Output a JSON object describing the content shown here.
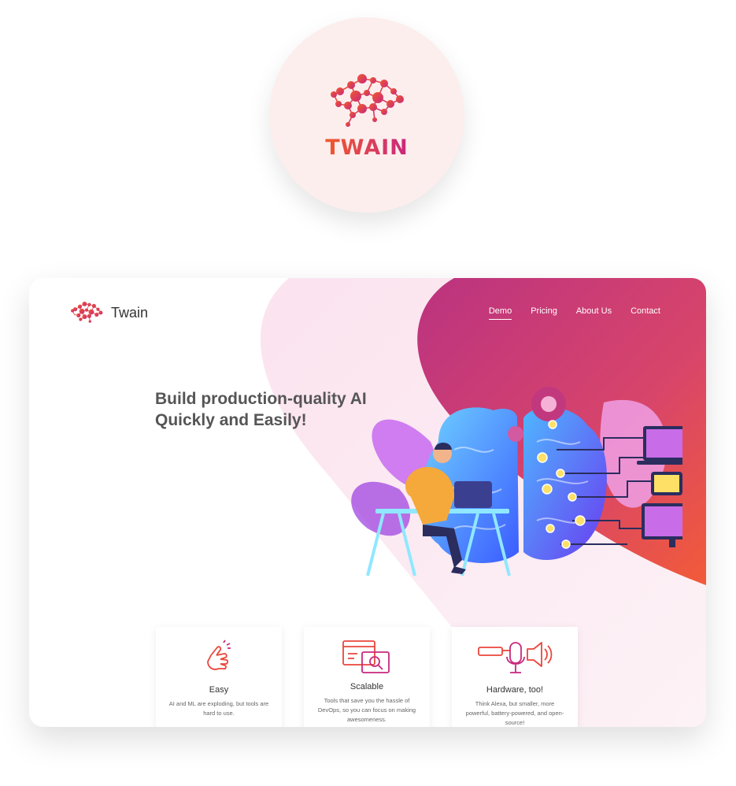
{
  "logo": {
    "wordmark": "TWAIN"
  },
  "site": {
    "brand": "Twain",
    "nav": [
      {
        "label": "Demo",
        "active": true
      },
      {
        "label": "Pricing",
        "active": false
      },
      {
        "label": "About Us",
        "active": false
      },
      {
        "label": "Contact",
        "active": false
      }
    ],
    "hero": {
      "line1": "Build production-quality AI",
      "line2": "Quickly and Easily!"
    },
    "features": [
      {
        "icon": "hand-snap-icon",
        "title": "Easy",
        "description": "AI and ML are exploding, but tools are hard to use."
      },
      {
        "icon": "browser-search-icon",
        "title": "Scalable",
        "description": "Tools that save you the hassle of DevOps, so you can focus on making awesomeness."
      },
      {
        "icon": "microphone-speaker-icon",
        "title": "Hardware, too!",
        "description": "Think Alexa, but smaller, more powerful, battery-powered, and open-source!"
      }
    ]
  },
  "colors": {
    "accent_start": "#f15a2b",
    "accent_end": "#c8287e",
    "hero_bg_start": "#c2387e",
    "hero_bg_end": "#ee5a3a",
    "text_dark": "#555555"
  }
}
